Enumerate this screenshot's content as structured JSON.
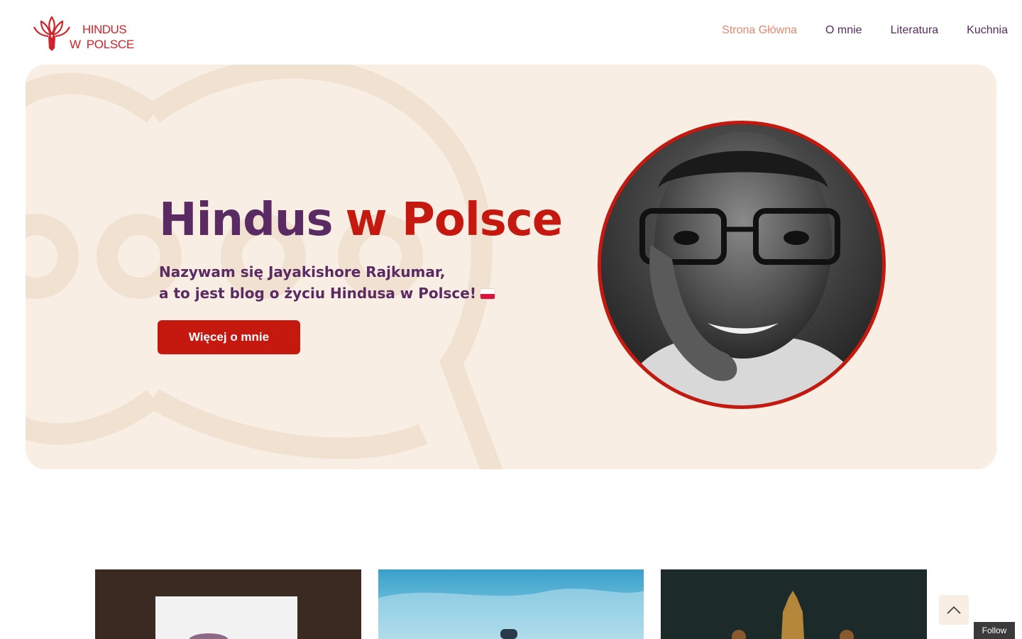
{
  "header": {
    "logo": {
      "line1": "HINDUS",
      "line2_w": "W",
      "line2_rest": "POLSCE"
    },
    "nav": [
      {
        "label": "Strona Główna",
        "active": true
      },
      {
        "label": "O mnie",
        "active": false
      },
      {
        "label": "Literatura",
        "active": false
      },
      {
        "label": "Kuchnia",
        "active": false
      }
    ]
  },
  "hero": {
    "title_part1": "Hindus",
    "title_part2": "w Polsce",
    "subtitle_line1": "Nazywam się Jayakishore Rajkumar,",
    "subtitle_line2": "a to jest blog o życiu Hindusa w Polsce!",
    "button_label": "Więcej o mnie"
  },
  "floating": {
    "follow_label": "Follow"
  },
  "colors": {
    "brand_red": "#c5180f",
    "brand_purple": "#5a2a63",
    "nav_active": "#e8866d",
    "hero_bg": "#f8eee3"
  }
}
